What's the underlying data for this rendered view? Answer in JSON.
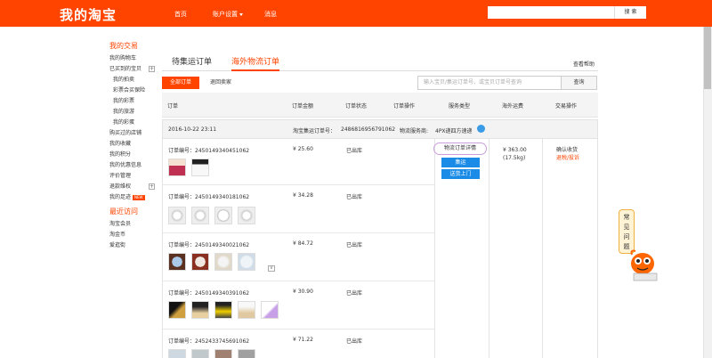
{
  "header": {
    "logo": "我的淘宝",
    "nav": [
      "首页",
      "账户设置",
      "消息"
    ],
    "search_button": "搜 索"
  },
  "sidebar": {
    "section1": "我的交易",
    "items": [
      {
        "label": "我的购物车",
        "sub": false
      },
      {
        "label": "已买到的宝贝",
        "sub": false,
        "plus": true
      },
      {
        "label": "我的拍卖",
        "sub": true
      },
      {
        "label": "彩票合买保险",
        "sub": true
      },
      {
        "label": "我的彩票",
        "sub": true
      },
      {
        "label": "我的旅游",
        "sub": true
      },
      {
        "label": "我的彩蛋",
        "sub": true
      },
      {
        "label": "购买过的店铺",
        "sub": false
      },
      {
        "label": "我的收藏",
        "sub": false
      },
      {
        "label": "我的积分",
        "sub": false
      },
      {
        "label": "我的优惠信息",
        "sub": false
      },
      {
        "label": "评价管理",
        "sub": false
      },
      {
        "label": "退款维权",
        "sub": false,
        "plus": true
      },
      {
        "label": "我的足迹",
        "sub": false,
        "new": true
      }
    ],
    "new_badge": "NEW",
    "section2": "最近访问",
    "recent": [
      "淘宝会员",
      "淘金币",
      "爱逛街"
    ]
  },
  "tabs": [
    "待集运订单",
    "海外物流订单"
  ],
  "help_link": "查看帮助",
  "filters": {
    "all": "全部订单",
    "return": "退回卖家"
  },
  "order_search": {
    "placeholder": "输入宝贝/集运订单号、或宝贝订单号查询",
    "button": "查询"
  },
  "columns": [
    "订单",
    "订单金额",
    "订单状态",
    "订单操作",
    "服务类型",
    "海外运费",
    "交易操作"
  ],
  "group": {
    "date": "2016-10-22 23:11",
    "consolidation_label": "淘宝集运订单号：",
    "consolidation_no": "2486816956791062",
    "provider_label": "物流服务商:",
    "provider": "4PX递四方速递"
  },
  "orders": [
    {
      "no": "订单编号：2450149340451062",
      "price": "¥ 25.60",
      "status": "已出库"
    },
    {
      "no": "订单编号：2450149340181062",
      "price": "¥ 34.28",
      "status": "已出库"
    },
    {
      "no": "订单编号：2450149340021062",
      "price": "¥ 84.72",
      "status": "已出库"
    },
    {
      "no": "订单编号：2450149340391062",
      "price": "¥ 30.90",
      "status": "已出库"
    },
    {
      "no": "订单编号：2452433745691062",
      "price": "¥ 71.22",
      "status": "已出库"
    }
  ],
  "service": {
    "detail": "物流订单详情",
    "btn1": "集运",
    "btn2": "送货上门"
  },
  "fee": {
    "amount": "¥ 363.00",
    "weight": "(17.5kg)"
  },
  "deal": {
    "confirm": "确认收货",
    "refund": "退税/投诉"
  },
  "help_widget": [
    "常",
    "见",
    "问",
    "题"
  ]
}
